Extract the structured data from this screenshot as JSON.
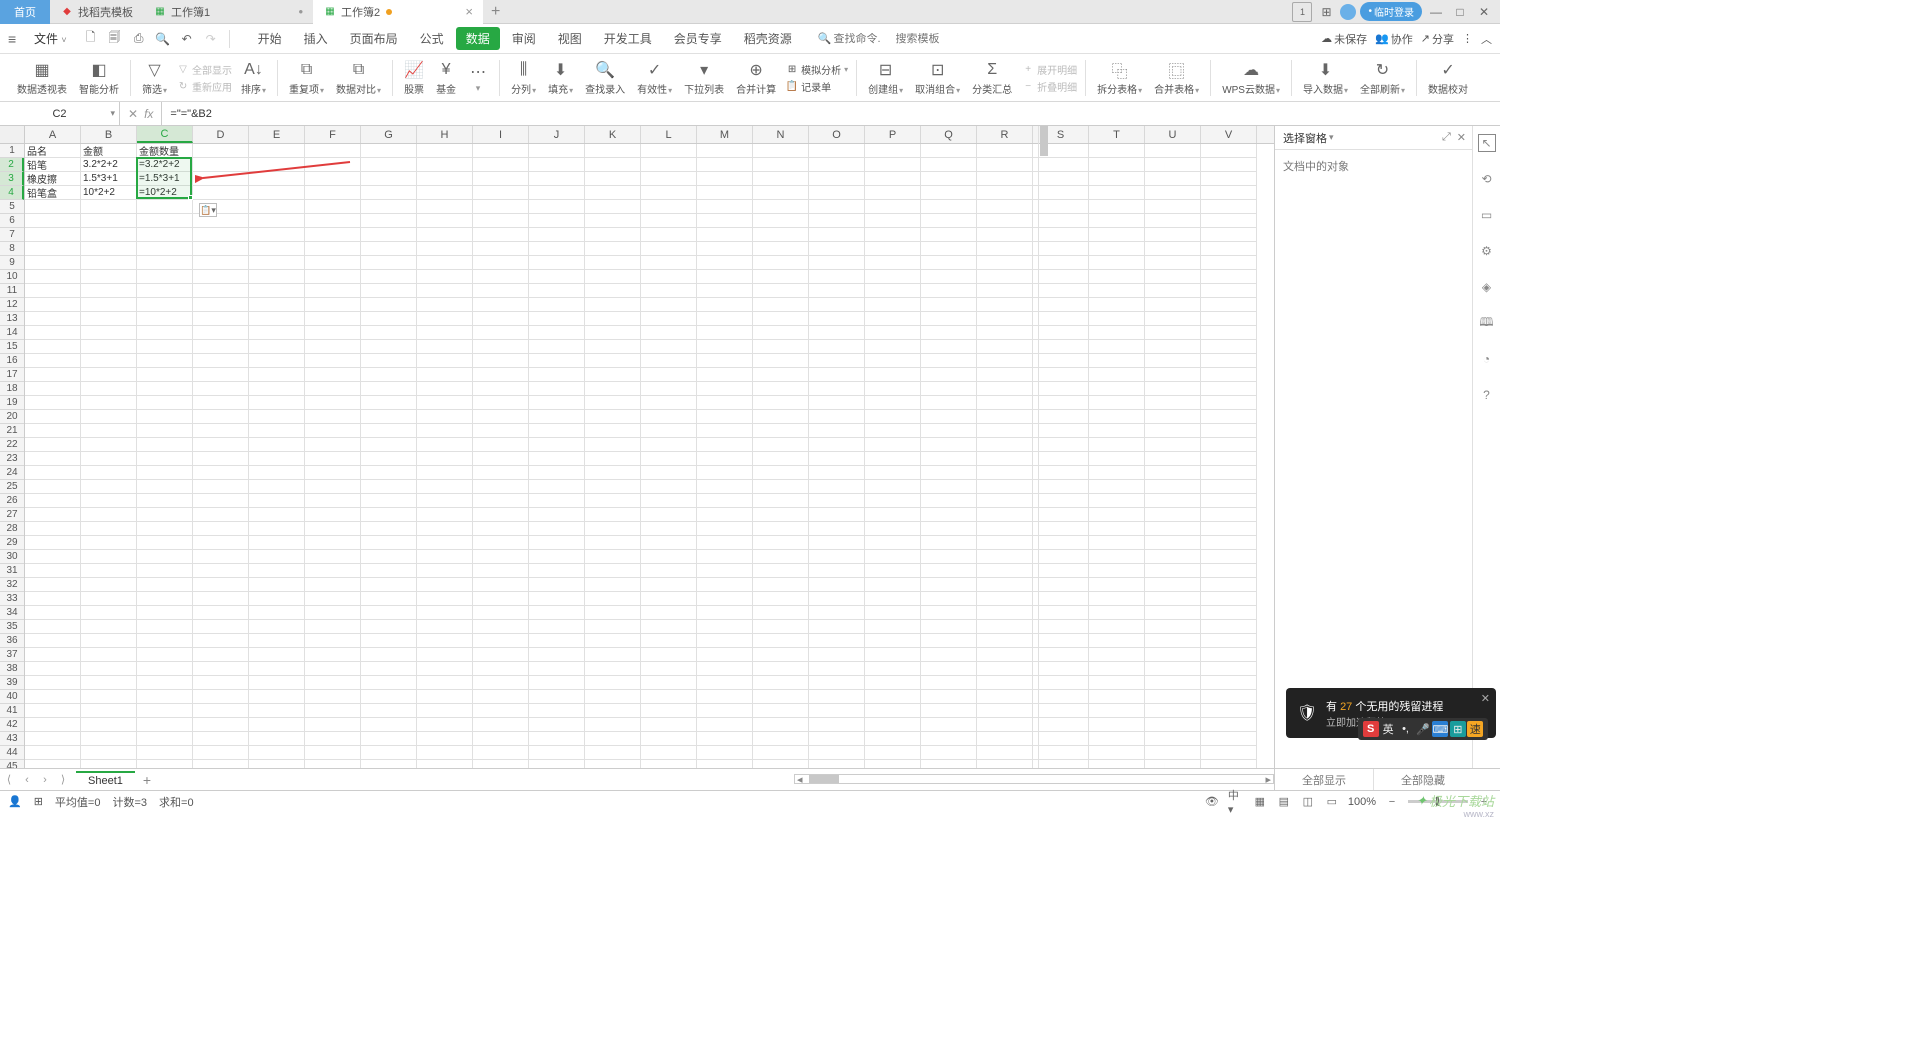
{
  "topTabs": {
    "home": "首页",
    "items": [
      {
        "icon": "tpl",
        "label": "找稻壳模板",
        "iconColor": "#e03c3c"
      },
      {
        "icon": "xls",
        "label": "工作簿1",
        "iconColor": "#27a843"
      },
      {
        "icon": "xls",
        "label": "工作簿2",
        "iconColor": "#27a843",
        "active": true,
        "modified": true
      }
    ],
    "rightControls": {
      "badge": "1",
      "login": "临时登录"
    }
  },
  "menuBar": {
    "file": "文件",
    "ribbonTabs": [
      "开始",
      "插入",
      "页面布局",
      "公式",
      "数据",
      "审阅",
      "视图",
      "开发工具",
      "会员专享",
      "稻壳资源"
    ],
    "activeTab": "数据",
    "searchPlaceholder1": "查找命令.",
    "searchPlaceholder2": "搜索模板",
    "right": {
      "unsaved": "未保存",
      "collab": "协作",
      "share": "分享"
    }
  },
  "ribbon": {
    "pivotTable": "数据透视表",
    "smartAnalysis": "智能分析",
    "filter": "筛选",
    "showAll": "全部显示",
    "reapply": "重新应用",
    "sort": "排序",
    "dedup": "重复项",
    "dataCompare": "数据对比",
    "stock": "股票",
    "fund": "基金",
    "splitCol": "分列",
    "fill": "填充",
    "findEntry": "查找录入",
    "validity": "有效性",
    "dropdown": "下拉列表",
    "consolidate": "合并计算",
    "simAnalysis": "模拟分析",
    "recordForm": "记录单",
    "createGroup": "创建组",
    "ungroup": "取消组合",
    "subtotal": "分类汇总",
    "expandDetail": "展开明细",
    "collapseDetail": "折叠明细",
    "splitTable": "拆分表格",
    "mergeTable": "合并表格",
    "wpsCloud": "WPS云数据",
    "importData": "导入数据",
    "refreshAll": "全部刷新",
    "dataCheck": "数据校对"
  },
  "formulaBar": {
    "cellRef": "C2",
    "formula": "=\"=\"&B2"
  },
  "columns": [
    "A",
    "B",
    "C",
    "D",
    "E",
    "F",
    "G",
    "H",
    "I",
    "J",
    "K",
    "L",
    "M",
    "N",
    "O",
    "P",
    "Q",
    "R",
    "S",
    "T",
    "U",
    "V"
  ],
  "selectedCols": [
    "C"
  ],
  "selectedRows": [
    2,
    3,
    4
  ],
  "rows": 45,
  "cellData": {
    "1": {
      "A": "品名",
      "B": "金额",
      "C": "金额数量"
    },
    "2": {
      "A": "铅笔",
      "B": "3.2*2+2",
      "C": "=3.2*2+2"
    },
    "3": {
      "A": "橡皮擦",
      "B": "1.5*3+1",
      "C": "=1.5*3+1"
    },
    "4": {
      "A": "铅笔盒",
      "B": "10*2+2",
      "C": "=10*2+2"
    }
  },
  "selection": {
    "col": "C",
    "startRow": 2,
    "endRow": 4
  },
  "rightPanel": {
    "title": "选择窗格",
    "body": "文档中的对象"
  },
  "sheetTabs": {
    "sheet": "Sheet1",
    "footerShowAll": "全部显示",
    "footerHideAll": "全部隐藏"
  },
  "statusBar": {
    "avg": "平均值=0",
    "count": "计数=3",
    "sum": "求和=0",
    "zoom": "100%"
  },
  "toast": {
    "prefix": "有 ",
    "num": "27",
    "suffix": " 个无用的残留进程",
    "sub": "立即加速释放",
    "btn": "速"
  },
  "watermark": {
    "text": "极光下载站",
    "sub": "www.xz"
  }
}
